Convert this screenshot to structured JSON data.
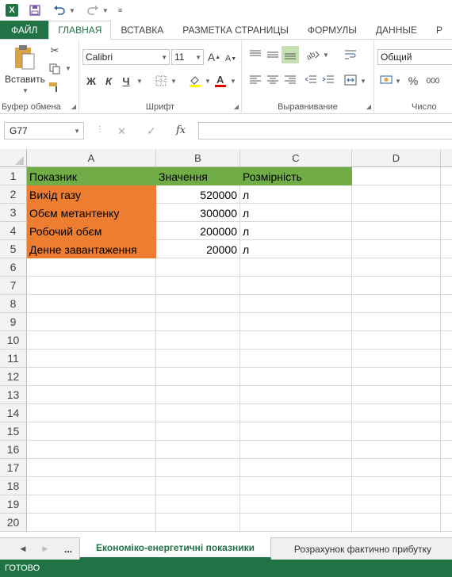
{
  "qat": {
    "app_icon": "X",
    "save_icon": "save-icon",
    "undo_icon": "undo-icon",
    "redo_icon": "redo-icon"
  },
  "tabs": [
    "ФАЙЛ",
    "ГЛАВНАЯ",
    "ВСТАВКА",
    "РАЗМЕТКА СТРАНИЦЫ",
    "ФОРМУЛЫ",
    "ДАННЫЕ",
    "Р"
  ],
  "ribbon": {
    "clipboard": {
      "paste_label": "Вставить",
      "group_label": "Буфер обмена"
    },
    "font": {
      "font_name": "Calibri",
      "font_size": "11",
      "bold": "Ж",
      "italic": "К",
      "underline": "Ч",
      "grow": "A",
      "shrink": "A",
      "group_label": "Шрифт"
    },
    "alignment": {
      "group_label": "Выравнивание"
    },
    "number": {
      "format": "Общий",
      "percent": "%",
      "thousands": "000",
      "group_label": "Число"
    }
  },
  "formula_bar": {
    "name_box": "G77",
    "cancel": "✕",
    "enter": "✓",
    "fx": "fx",
    "value": ""
  },
  "columns": [
    "A",
    "B",
    "C",
    "D"
  ],
  "rows": [
    {
      "n": "1",
      "a": "Показник",
      "b": "Значення",
      "c": "Розмірність"
    },
    {
      "n": "2",
      "a": "Вихід газу",
      "b": "520000",
      "c": "л"
    },
    {
      "n": "3",
      "a": "Обєм метантенку",
      "b": "300000",
      "c": "л"
    },
    {
      "n": "4",
      "a": "Робочий обєм",
      "b": "200000",
      "c": "л"
    },
    {
      "n": "5",
      "a": "Денне завантаження",
      "b": "20000",
      "c": "л"
    },
    {
      "n": "6"
    },
    {
      "n": "7"
    },
    {
      "n": "8"
    },
    {
      "n": "9"
    },
    {
      "n": "10"
    },
    {
      "n": "11"
    },
    {
      "n": "12"
    },
    {
      "n": "13"
    },
    {
      "n": "14"
    },
    {
      "n": "15"
    },
    {
      "n": "16"
    },
    {
      "n": "17"
    },
    {
      "n": "18"
    },
    {
      "n": "19"
    },
    {
      "n": "20"
    }
  ],
  "colors": {
    "header_green": "#70ad47",
    "label_orange": "#ed7d31",
    "excel_green": "#217346"
  },
  "sheet_tabs": {
    "more": "...",
    "active": "Економіко-енергетичні показники",
    "other": "Розрахунок фактично прибутку"
  },
  "status": "ГОТОВО"
}
